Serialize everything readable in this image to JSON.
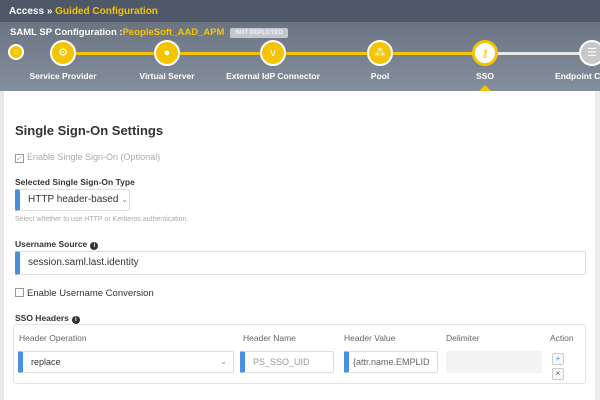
{
  "breadcrumb": {
    "root": "Access",
    "sep": "»",
    "current": "Guided Configuration"
  },
  "config": {
    "label": "SAML SP Configuration :",
    "name": "PeopleSoft_AAD_APM",
    "status": "NOT DEPLOYED"
  },
  "steps": [
    {
      "label": "Service Provider",
      "icon": "gears-icon"
    },
    {
      "label": "Virtual Server",
      "icon": "globe-icon"
    },
    {
      "label": "External IdP Connector",
      "icon": "connector-icon"
    },
    {
      "label": "Pool",
      "icon": "sitemap-icon"
    },
    {
      "label": "SSO",
      "icon": "key-icon"
    },
    {
      "label": "Endpoint C",
      "icon": "list-icon"
    }
  ],
  "page": {
    "title": "Single Sign-On Settings",
    "enable_sso": "Enable Single Sign-On (Optional)",
    "sso_type_label": "Selected Single Sign-On Type",
    "sso_type_value": "HTTP header-based",
    "sso_type_help": "Select whether to use HTTP or Kerberos authentication.",
    "username_source_label": "Username Source",
    "username_source_value": "session.saml.last.identity",
    "enable_username_conversion": "Enable Username Conversion",
    "sso_headers_label": "SSO Headers"
  },
  "table": {
    "headers": [
      "Header Operation",
      "Header Name",
      "Header Value",
      "Delimiter",
      "Action"
    ],
    "row": {
      "operation": "replace",
      "name": "PS_SSO_UID",
      "value": "attr.name.EMPLID}",
      "delimiter": ""
    },
    "add": "+",
    "remove": "×"
  }
}
